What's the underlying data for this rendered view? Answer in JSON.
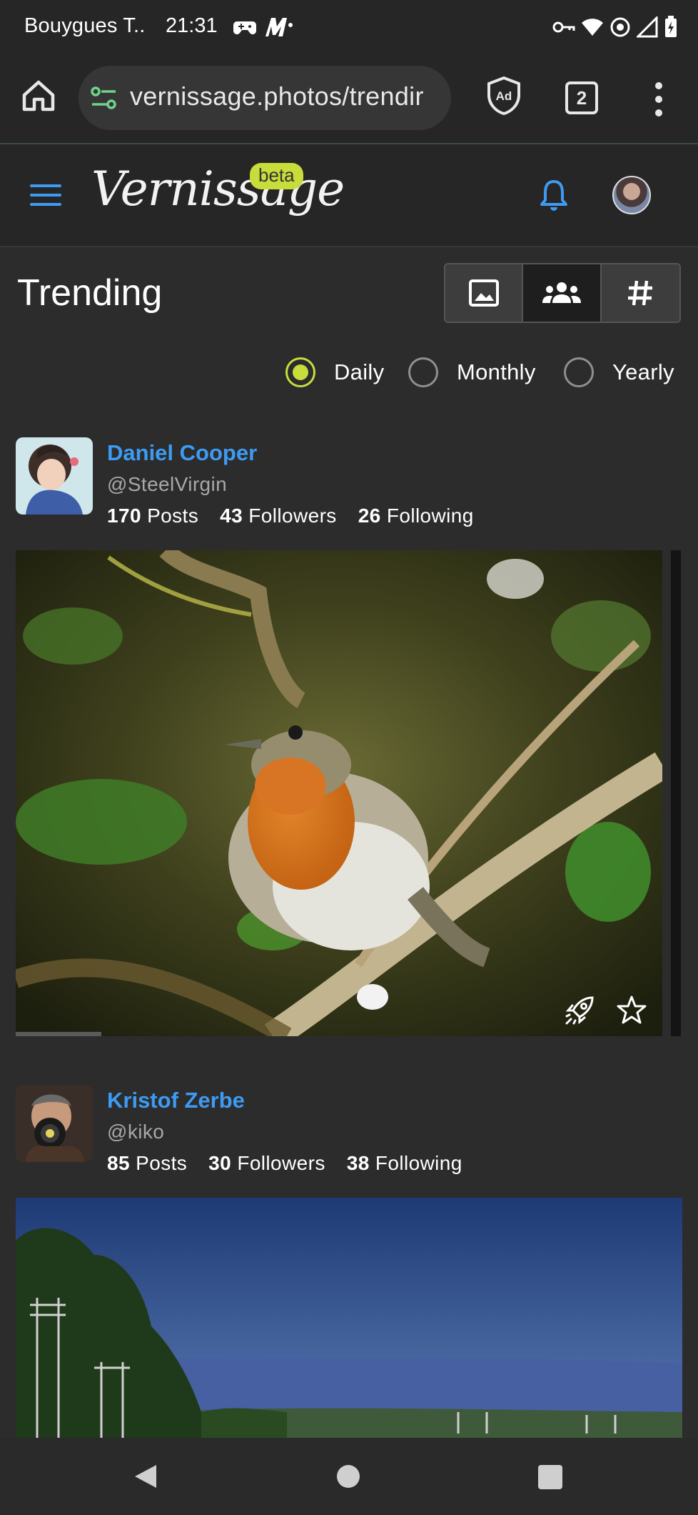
{
  "status_bar": {
    "carrier": "Bouygues T..",
    "time": "21:31"
  },
  "browser": {
    "url": "vernissage.photos/trendir",
    "tab_count": "2"
  },
  "app": {
    "logo": "Vernissage",
    "beta": "beta"
  },
  "trending": {
    "title": "Trending",
    "view_modes": [
      {
        "icon": "image-icon",
        "active": false
      },
      {
        "icon": "users-icon",
        "active": true
      },
      {
        "icon": "hashtag-icon",
        "active": false
      }
    ],
    "periods": [
      {
        "label": "Daily",
        "checked": true
      },
      {
        "label": "Monthly",
        "checked": false
      },
      {
        "label": "Yearly",
        "checked": false
      }
    ]
  },
  "profiles": [
    {
      "name": "Daniel Cooper",
      "handle": "@SteelVirgin",
      "posts": "170",
      "posts_label": "Posts",
      "followers": "43",
      "followers_label": "Followers",
      "following": "26",
      "following_label": "Following"
    },
    {
      "name": "Kristof Zerbe",
      "handle": "@kiko",
      "posts": "85",
      "posts_label": "Posts",
      "followers": "30",
      "followers_label": "Followers",
      "following": "38",
      "following_label": "Following"
    }
  ],
  "colors": {
    "accent": "#3d9bf3",
    "lime": "#c8dc3c",
    "background": "#2c2c2c"
  }
}
